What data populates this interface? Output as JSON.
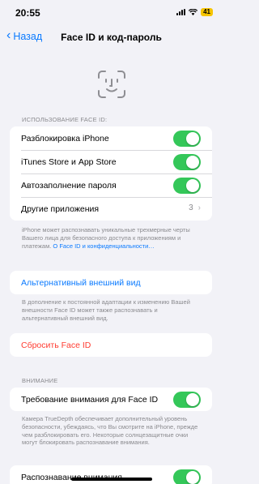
{
  "status_bar": {
    "time": "20:55",
    "battery": "41"
  },
  "nav": {
    "back_label": "Назад",
    "title": "Face ID и код-пароль"
  },
  "usage_section": {
    "header": "ИСПОЛЬЗОВАНИЕ FACE ID:",
    "rows": [
      {
        "label": "Разблокировка iPhone",
        "toggle_on": true
      },
      {
        "label": "iTunes Store и App Store",
        "toggle_on": true
      },
      {
        "label": "Автозаполнение пароля",
        "toggle_on": true
      },
      {
        "label": "Другие приложения",
        "value": "3"
      }
    ],
    "footnote": "iPhone может распознавать уникальные трехмерные черты Вашего лица для безопасного доступа к приложениям и платежам.",
    "footnote_link": "О Face ID и конфиденциальности…"
  },
  "alt_appearance": {
    "label": "Альтернативный внешний вид",
    "footnote": "В дополнение к постоянной адаптации к изменению Вашей внешности Face ID может также распознавать и альтернативный внешний вид."
  },
  "reset": {
    "label": "Сбросить Face ID"
  },
  "attention_section": {
    "header": "ВНИМАНИЕ",
    "row_label": "Требование внимания для Face ID",
    "toggle_on": true,
    "footnote": "Камера TrueDepth обеспечивает дополнительный уровень безопасности, убеждаясь, что Вы смотрите на iPhone, прежде чем разблокировать его. Некоторые солнцезащитные очки могут блокировать распознавание внимания."
  },
  "attention_aware": {
    "label": "Распознавание внимания",
    "toggle_on": true
  },
  "colors": {
    "accent": "#0a7aff",
    "toggle_on": "#34c759",
    "destructive": "#ff3b30",
    "background": "#f2f2f7"
  }
}
